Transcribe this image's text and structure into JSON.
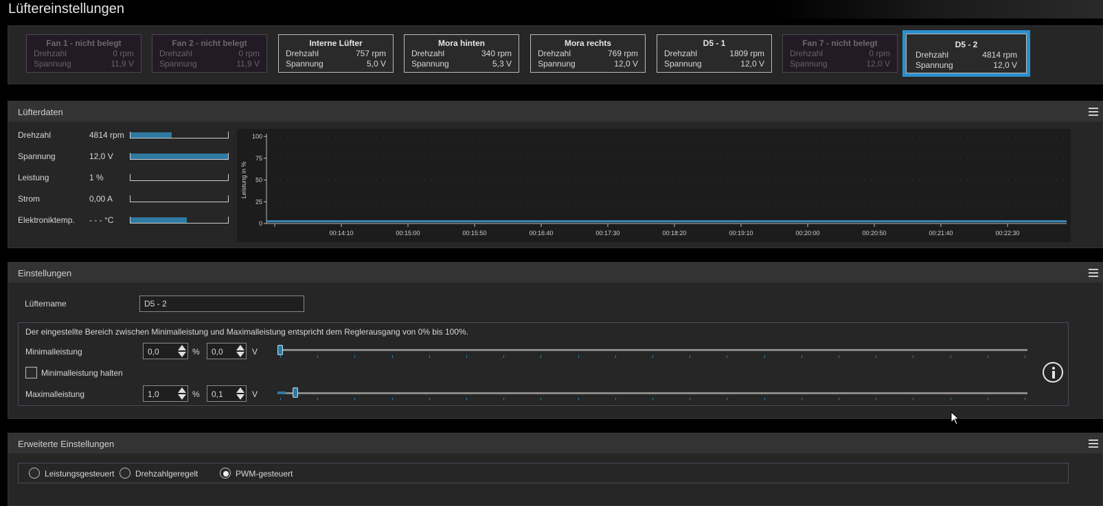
{
  "window": {
    "title": "Lüftereinstellungen"
  },
  "fans": [
    {
      "name": "Fan 1 - nicht belegt",
      "rpm_label": "Drehzahl",
      "rpm": "0 rpm",
      "volt_label": "Spannung",
      "volt": "11,9 V",
      "state": "inactive"
    },
    {
      "name": "Fan 2 - nicht belegt",
      "rpm_label": "Drehzahl",
      "rpm": "0 rpm",
      "volt_label": "Spannung",
      "volt": "11,9 V",
      "state": "inactive"
    },
    {
      "name": "Interne Lüfter",
      "rpm_label": "Drehzahl",
      "rpm": "757 rpm",
      "volt_label": "Spannung",
      "volt": "5,0 V",
      "state": "active"
    },
    {
      "name": "Mora hinten",
      "rpm_label": "Drehzahl",
      "rpm": "340 rpm",
      "volt_label": "Spannung",
      "volt": "5,3 V",
      "state": "active"
    },
    {
      "name": "Mora rechts",
      "rpm_label": "Drehzahl",
      "rpm": "769 rpm",
      "volt_label": "Spannung",
      "volt": "12,0 V",
      "state": "active"
    },
    {
      "name": "D5 - 1",
      "rpm_label": "Drehzahl",
      "rpm": "1809 rpm",
      "volt_label": "Spannung",
      "volt": "12,0 V",
      "state": "active"
    },
    {
      "name": "Fan 7 - nicht belegt",
      "rpm_label": "Drehzahl",
      "rpm": "0 rpm",
      "volt_label": "Spannung",
      "volt": "12,0 V",
      "state": "inactive"
    },
    {
      "name": "D5 - 2",
      "rpm_label": "Drehzahl",
      "rpm": "4814 rpm",
      "volt_label": "Spannung",
      "volt": "12,0 V",
      "state": "selected"
    }
  ],
  "fan_data": {
    "title": "Lüfterdaten",
    "rows": [
      {
        "label": "Drehzahl",
        "value": "4814 rpm",
        "fill": 0.42
      },
      {
        "label": "Spannung",
        "value": "12,0 V",
        "fill": 1.0
      },
      {
        "label": "Leistung",
        "value": "1 %",
        "fill": 0.0
      },
      {
        "label": "Strom",
        "value": "0,00 A",
        "fill": 0.0
      },
      {
        "label": "Elektroniktemp.",
        "value": "- - - °C",
        "fill": 0.58
      }
    ]
  },
  "chart_data": {
    "type": "line",
    "ylabel": "Leistung in %",
    "ylim": [
      0,
      100
    ],
    "yticks": [
      "100",
      "75",
      "50",
      "25",
      "0"
    ],
    "x": [
      "00:14:10",
      "00:15:00",
      "00:15:50",
      "00:16:40",
      "00:17:30",
      "00:18:20",
      "00:19:10",
      "00:20:00",
      "00:20:50",
      "00:21:40",
      "00:22:30"
    ],
    "series": [
      {
        "values": [
          1,
          1,
          1,
          1,
          1,
          1,
          1,
          1,
          1,
          1,
          1
        ]
      }
    ],
    "colors": {
      "line": "#3a8cc0"
    },
    "grid": true
  },
  "settings": {
    "title": "Einstellungen",
    "fan_name_label": "Lüftername",
    "fan_name_value": "D5 - 2",
    "range_note": "Der eingestellte Bereich zwischen Minimalleistung und Maximalleistung entspricht dem Reglerausgang von 0% bis 100%.",
    "min": {
      "label": "Minimalleistung",
      "percent": "0,0",
      "percent_unit": "%",
      "volt": "0,0",
      "volt_unit": "V",
      "slider_value": 0.0
    },
    "hold_min_label": "Minimalleistung halten",
    "max": {
      "label": "Maximalleistung",
      "percent": "1,0",
      "percent_unit": "%",
      "volt": "0,1",
      "volt_unit": "V",
      "slider_value": 0.01
    }
  },
  "advanced": {
    "title": "Erweiterte Einstellungen",
    "modes": [
      {
        "label": "Leistungsgesteuert",
        "selected": false
      },
      {
        "label": "Drehzahlgeregelt",
        "selected": false
      },
      {
        "label": "PWM-gesteuert",
        "selected": true
      }
    ]
  }
}
